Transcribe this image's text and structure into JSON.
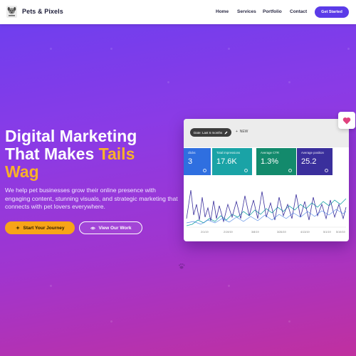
{
  "nav": {
    "brand": "Pets & Pixels",
    "links": [
      "Home",
      "Services",
      "Portfolio",
      "Contact"
    ],
    "cta": "Get Started"
  },
  "hero": {
    "title_line1": "Digital Marketing",
    "title_line2a": "That Makes ",
    "title_highlight": "Tails",
    "title_line3": "Wag",
    "subtitle": "We help pet businesses grow their online presence with engaging content, stunning visuals, and strategic marketing that connects with pet lovers everywhere.",
    "primary_button": "Start Your Journey",
    "secondary_button": "View Our Work"
  },
  "dashboard": {
    "date_range": "Date: Last 6 months",
    "new_label": "NEW",
    "tiles": [
      {
        "label": "clicks",
        "value": "3",
        "color": "#2f6fe0"
      },
      {
        "label": "Total impressions",
        "value": "17.6K",
        "color": "#1aa3a6"
      },
      {
        "label": "Average CTR",
        "value": "1.3%",
        "color": "#138a6c"
      },
      {
        "label": "Average position",
        "value": "25.2",
        "color": "#3a2f9c"
      }
    ],
    "x_ticks": [
      "2/1/19",
      "2/19/19",
      "3/8/19",
      "3/26/19",
      "4/13/19",
      "5/1/19",
      "5/19/19"
    ]
  },
  "colors": {
    "accent": "#f7b12a",
    "brand_button": "#5b3be8",
    "heart": "#e0427e"
  },
  "icons": {
    "logo": "dog-logo-icon",
    "heart": "heart-icon",
    "primary_button_icon": "sparkle-icon",
    "secondary_button_icon": "eye-icon",
    "paw": "paw-print-icon"
  }
}
